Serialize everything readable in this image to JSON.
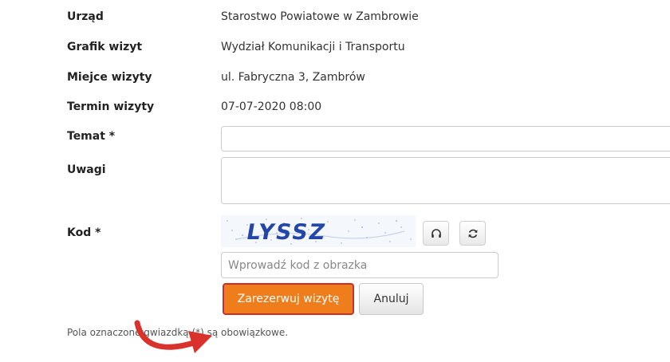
{
  "form": {
    "rows": [
      {
        "label": "Urząd",
        "value": "Starostwo Powiatowe w Zambrowie"
      },
      {
        "label": "Grafik wizyt",
        "value": "Wydział Komunikacji i Transportu"
      },
      {
        "label": "Miejce wizyty",
        "value": "ul. Fabryczna 3, Zambrów"
      },
      {
        "label": "Termin wizyty",
        "value": "07-07-2020 08:00"
      }
    ],
    "temat": {
      "label": "Temat *",
      "value": ""
    },
    "uwagi": {
      "label": "Uwagi",
      "value": ""
    },
    "kod": {
      "label": "Kod *",
      "captcha_text": "LYSSZ",
      "audio_icon": "headphones-icon",
      "refresh_icon": "refresh-icon",
      "input_placeholder": "Wprowadź kod z obrazka",
      "input_value": ""
    },
    "buttons": {
      "submit_label": "Zarezerwuj wizytę",
      "cancel_label": "Anuluj"
    },
    "required_note": "Pola oznaczone gwiazdką (*) są obowiązkowe."
  },
  "colors": {
    "primary": "#ef7d1b",
    "primary_border": "#c9302c",
    "arrow": "#d9312b",
    "captcha_text": "#2446a6"
  }
}
